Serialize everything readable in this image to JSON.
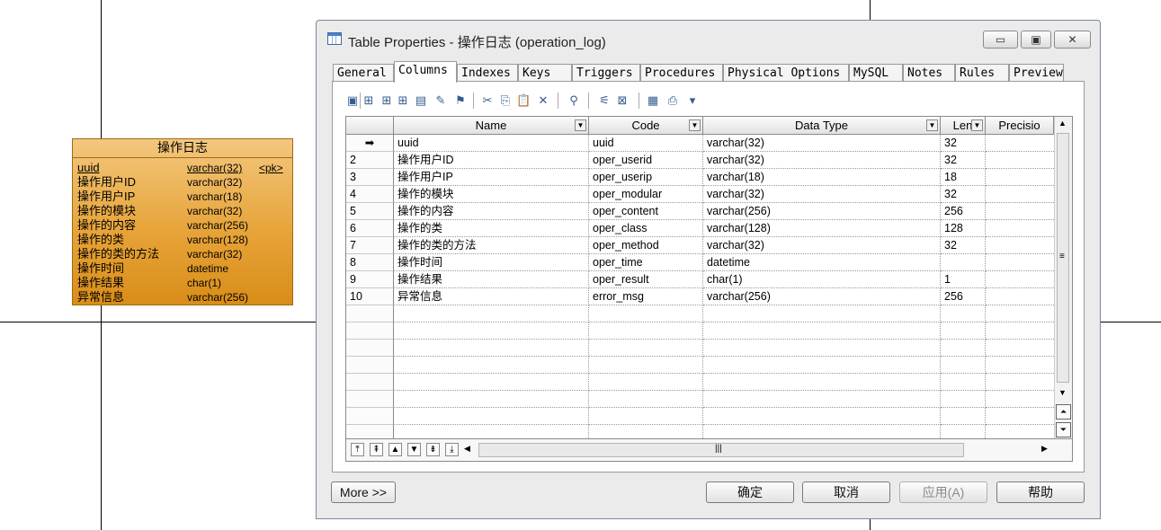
{
  "entity": {
    "title": "操作日志",
    "rows": [
      {
        "name": "uuid",
        "type": "varchar(32)",
        "key": "<pk>"
      },
      {
        "name": "操作用户ID",
        "type": "varchar(32)",
        "key": ""
      },
      {
        "name": "操作用户IP",
        "type": "varchar(18)",
        "key": ""
      },
      {
        "name": "操作的模块",
        "type": "varchar(32)",
        "key": ""
      },
      {
        "name": "操作的内容",
        "type": "varchar(256)",
        "key": ""
      },
      {
        "name": "操作的类",
        "type": "varchar(128)",
        "key": ""
      },
      {
        "name": "操作的类的方法",
        "type": "varchar(32)",
        "key": ""
      },
      {
        "name": "操作时间",
        "type": "datetime",
        "key": ""
      },
      {
        "name": "操作结果",
        "type": "char(1)",
        "key": ""
      },
      {
        "name": "异常信息",
        "type": "varchar(256)",
        "key": ""
      }
    ]
  },
  "dialog": {
    "title": "Table Properties - 操作日志 (operation_log)",
    "window_buttons": {
      "minimize": "▭",
      "maximize": "▣",
      "close": "✕"
    },
    "tabs": [
      "General",
      "Columns",
      "Indexes",
      "Keys",
      "Triggers",
      "Procedures",
      "Physical Options",
      "MySQL",
      "Notes",
      "Rules",
      "Preview"
    ],
    "active_tab": "Columns",
    "toolbar_icons": [
      "properties-icon",
      "add-row-icon",
      "insert-row-icon",
      "add-columns-icon",
      "domain-icon",
      "reuse-icon",
      "magic-icon",
      "cut-icon",
      "copy-icon",
      "paste-icon",
      "delete-icon",
      "find-icon",
      "filter-icon",
      "customize-columns-icon",
      "excel-export-icon",
      "print-icon",
      "dropdown-icon"
    ],
    "grid": {
      "headers": [
        "Name",
        "Code",
        "Data Type",
        "Len",
        "Precisio"
      ],
      "rows": [
        {
          "num": "➡",
          "name": "uuid",
          "code": "uuid",
          "type": "varchar(32)",
          "len": "32"
        },
        {
          "num": "2",
          "name": "操作用户ID",
          "code": "oper_userid",
          "type": "varchar(32)",
          "len": "32"
        },
        {
          "num": "3",
          "name": "操作用户IP",
          "code": "oper_userip",
          "type": "varchar(18)",
          "len": "18"
        },
        {
          "num": "4",
          "name": "操作的模块",
          "code": "oper_modular",
          "type": "varchar(32)",
          "len": "32"
        },
        {
          "num": "5",
          "name": "操作的内容",
          "code": "oper_content",
          "type": "varchar(256)",
          "len": "256"
        },
        {
          "num": "6",
          "name": "操作的类",
          "code": "oper_class",
          "type": "varchar(128)",
          "len": "128"
        },
        {
          "num": "7",
          "name": "操作的类的方法",
          "code": "oper_method",
          "type": "varchar(32)",
          "len": "32"
        },
        {
          "num": "8",
          "name": "操作时间",
          "code": "oper_time",
          "type": "datetime",
          "len": ""
        },
        {
          "num": "9",
          "name": "操作结果",
          "code": "oper_result",
          "type": "char(1)",
          "len": "1"
        },
        {
          "num": "10",
          "name": "异常信息",
          "code": "error_msg",
          "type": "varchar(256)",
          "len": "256"
        }
      ],
      "empty_rows": 8,
      "nav_buttons": [
        "⤒",
        "⇞",
        "▲",
        "▼",
        "⇟",
        "⤓"
      ]
    },
    "buttons": {
      "more": "More >>",
      "ok": "确定",
      "cancel": "取消",
      "apply": "应用(A)",
      "help": "帮助"
    }
  }
}
